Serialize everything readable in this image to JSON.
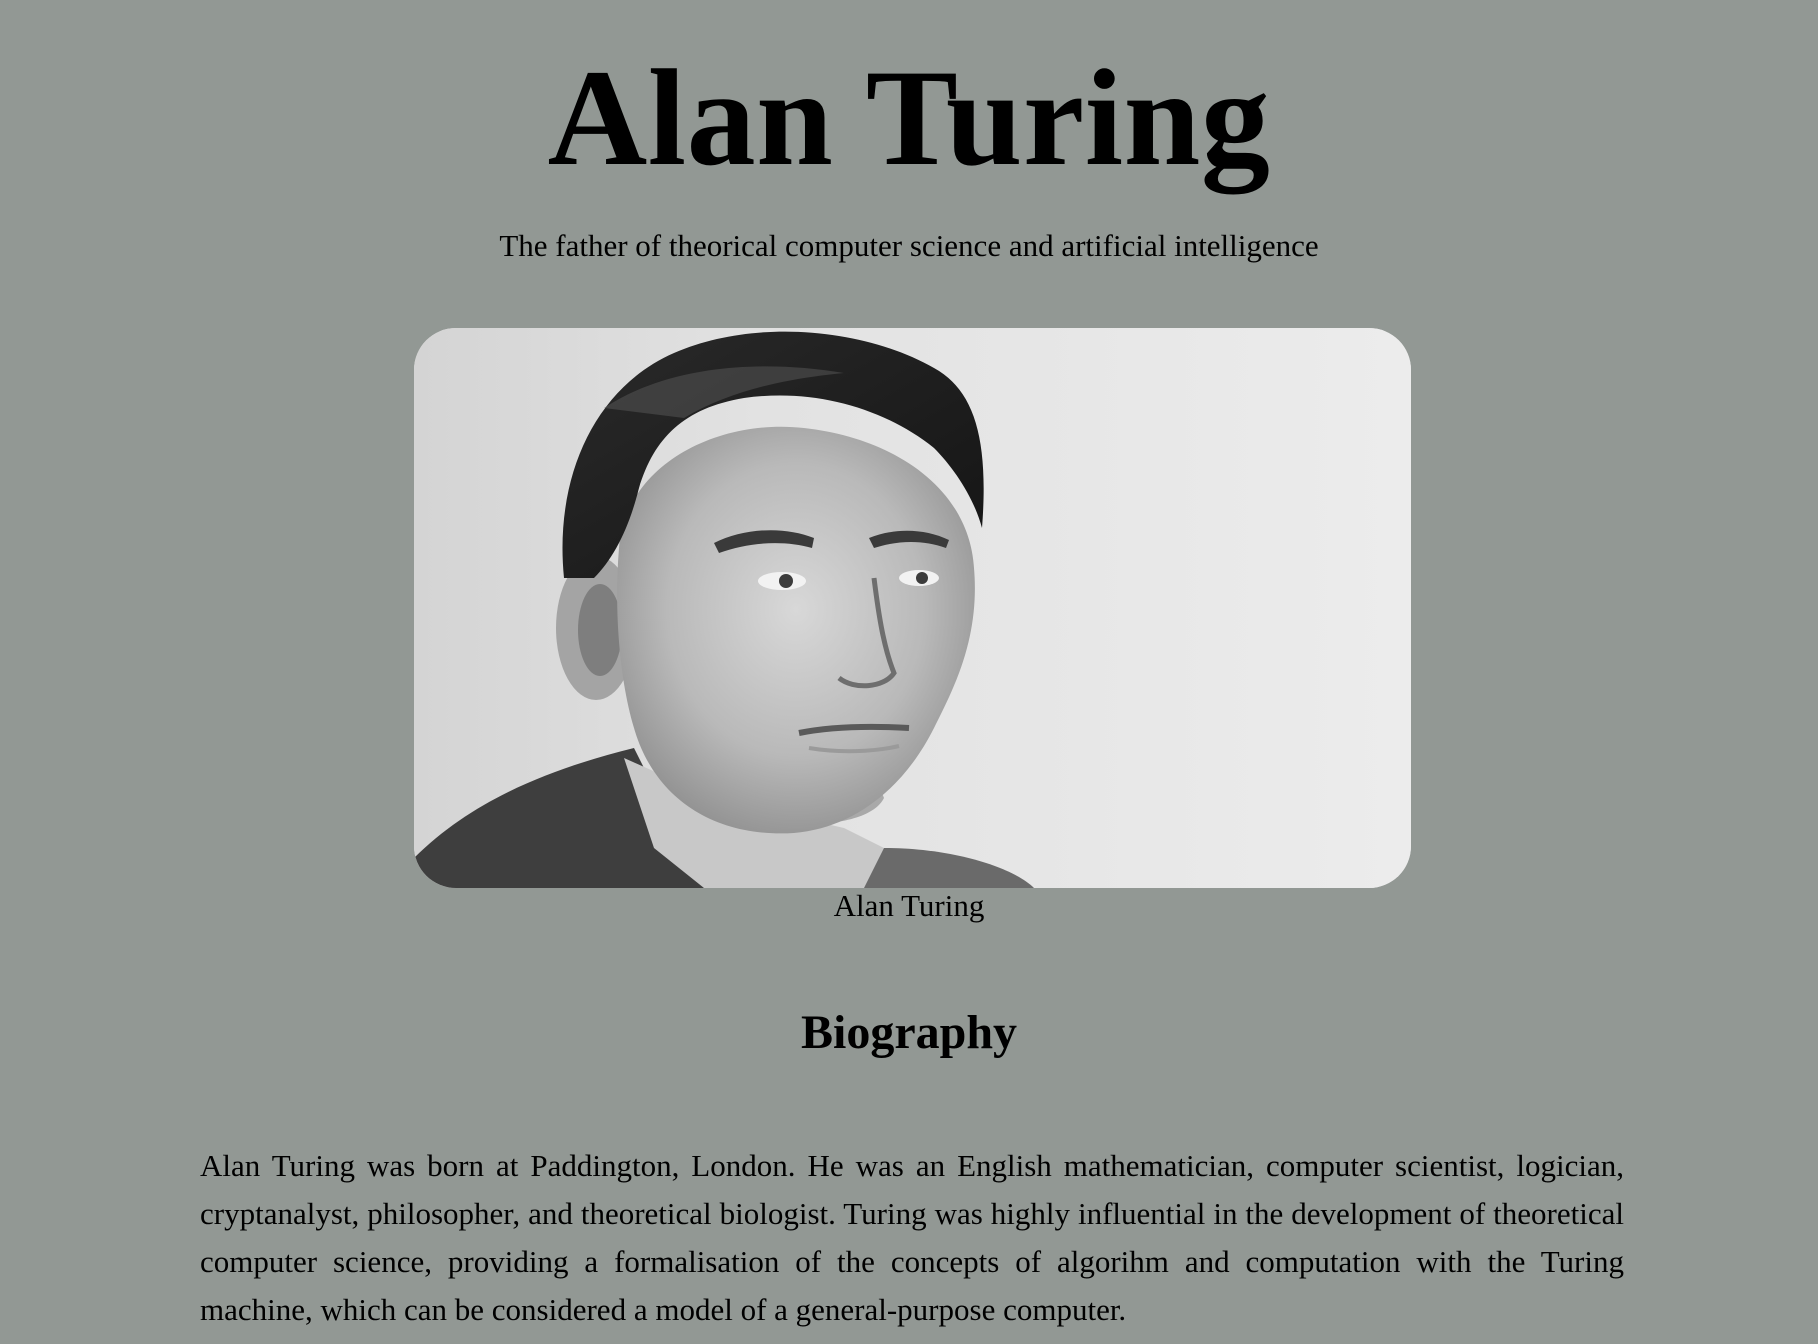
{
  "header": {
    "title": "Alan Turing",
    "subtitle": "The father of theorical computer science and artificial intelligence"
  },
  "figure": {
    "image_icon": "portrait-photo",
    "caption": "Alan Turing"
  },
  "biography": {
    "heading": "Biography",
    "text": "Alan Turing was born at Paddington, London. He was an English mathematician, computer scientist, logician, cryptanalyst, philosopher, and theoretical biologist. Turing was highly influential in the development of theoretical computer science, providing a formalisation of the concepts of algorihm and computation with the Turing machine, which can be considered a model of a general-purpose computer."
  },
  "colors": {
    "background": "#929894",
    "text": "#000000"
  }
}
